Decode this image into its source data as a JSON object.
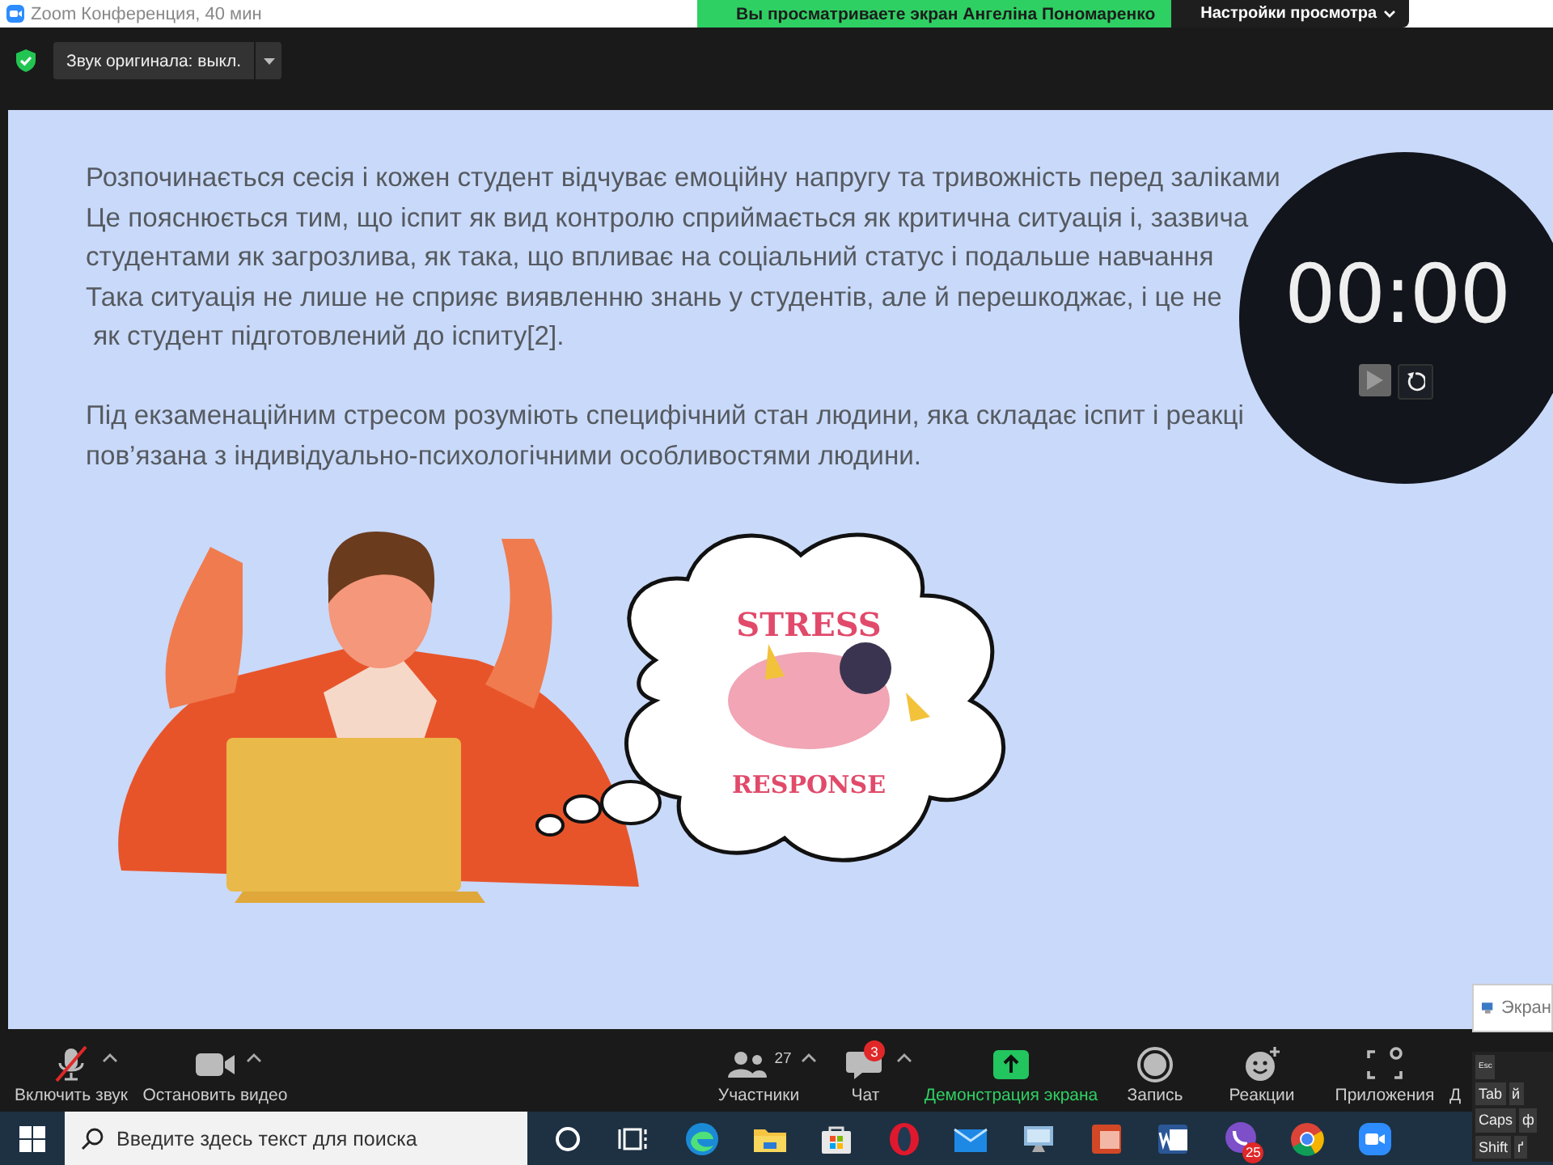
{
  "window": {
    "title": "Zoom Конференция, 40 мин"
  },
  "share_banner": {
    "text": "Вы просматриваете экран Ангеліна Пономаренко",
    "menu": "Настройки просмотра"
  },
  "original_sound": {
    "label": "Звук оригинала: выкл."
  },
  "slide": {
    "paragraphs": [
      [
        "Розпочинається сесія і кожен студент відчуває емоційну напругу та тривожність перед заліками",
        "Це пояснюється тим, що іспит як вид контролю сприймається як критична ситуація і, зазвича",
        "студентами як загрозлива, як така, що впливає на соціальний статус і подальше навчання",
        "Така ситуація не лише не сприяє виявленню знань у студентів, але й перешкоджає, і це не",
        " як студент підготовлений до іспиту[2]."
      ],
      [
        "Під екзаменаційним стресом розуміють специфічний стан людини, яка складає іспит і реакці",
        "пов’язана з індивідуально-психологічними особливостями людини."
      ]
    ],
    "bubble_words": [
      "STRESS",
      "RESPONSE"
    ]
  },
  "timer": {
    "time": "00:00"
  },
  "toolbar": {
    "items": [
      {
        "kind": "mic",
        "label": "Включить звук",
        "muted": true
      },
      {
        "kind": "video",
        "label": "Остановить видео"
      },
      {
        "kind": "participants",
        "label": "Участники",
        "count": "27"
      },
      {
        "kind": "chat",
        "label": "Чат",
        "badge": "3"
      },
      {
        "kind": "share",
        "label": "Демонстрация экрана"
      },
      {
        "kind": "record",
        "label": "Запись"
      },
      {
        "kind": "reactions",
        "label": "Реакции"
      },
      {
        "kind": "apps",
        "label": "Приложения"
      },
      {
        "kind": "more",
        "label": "Д"
      }
    ]
  },
  "taskbar": {
    "search": {
      "placeholder": "Введите здесь текст для поиска"
    },
    "apps": [
      {
        "kind": "cortana"
      },
      {
        "kind": "taskview"
      },
      {
        "kind": "edge"
      },
      {
        "kind": "explorer"
      },
      {
        "kind": "store"
      },
      {
        "kind": "opera"
      },
      {
        "kind": "mail"
      },
      {
        "kind": "monitor"
      },
      {
        "kind": "powerpoint"
      },
      {
        "kind": "word"
      },
      {
        "kind": "viber",
        "badge": "25"
      },
      {
        "kind": "chrome"
      },
      {
        "kind": "zoom"
      }
    ]
  },
  "popup": {
    "title": "Экран"
  },
  "keyboard": {
    "rows": [
      [
        "Esc"
      ],
      [
        "Tab",
        "й"
      ],
      [
        "Caps",
        "ф"
      ],
      [
        "Shift",
        "ґ"
      ]
    ]
  }
}
